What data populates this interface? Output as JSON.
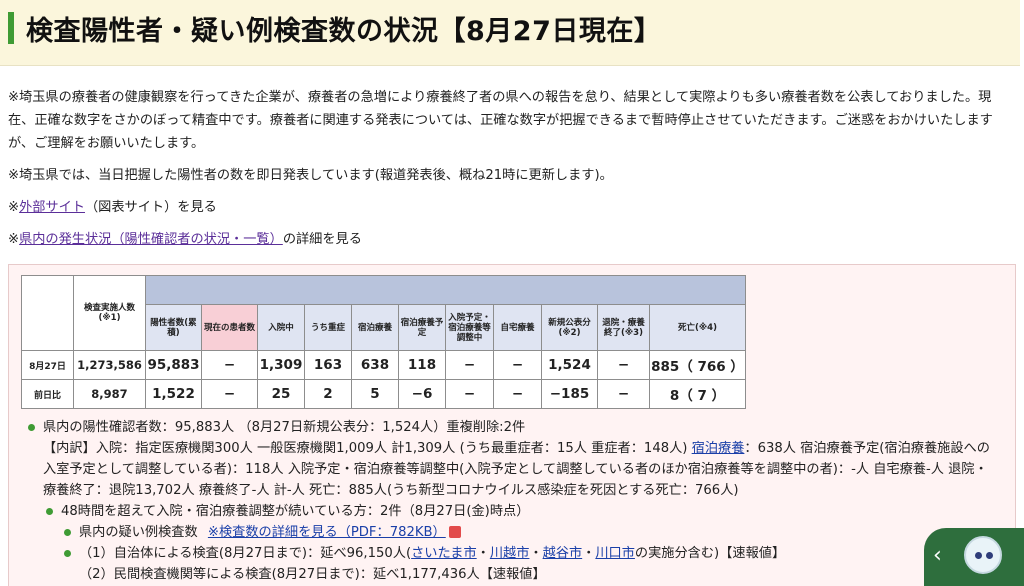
{
  "title": "検査陽性者・疑い例検査数の状況【8月27日現在】",
  "notes": {
    "notice": "※埼玉県の療養者の健康観察を行ってきた企業が、療養者の急増により療養終了者の県への報告を怠り、結果として実際よりも多い療養者数を公表しておりました。現在、正確な数字をさかのぼって精査中です。療養者に関連する発表については、正確な数字が把握できるまで暫時停止させていただきます。ご迷惑をおかけいたしますが、ご理解をお願いいたします。",
    "daily": "※埼玉県では、当日把握した陽性者の数を即日発表しています(報道発表後、概ね21時に更新します)。",
    "external_prefix": "※",
    "external_link": "外部サイト",
    "external_suffix": "（図表サイト）を見る",
    "local_prefix": "※",
    "local_link": "県内の発生状況（陽性確認者の状況・一覧）",
    "local_suffix": "の詳細を見る"
  },
  "table": {
    "headers": [
      "検査実施人数(※1)",
      "陽性者数(累積)",
      "現在の患者数",
      "入院中",
      "うち重症",
      "宿泊療養",
      "宿泊療養予定",
      "入院予定・宿泊療養等調整中",
      "自宅療養",
      "新規公表分(※2)",
      "退院・療養終了(※3)",
      "死亡(※4)"
    ],
    "rows": [
      {
        "label": "8月27日",
        "cells": [
          "1,273,586",
          "95,883",
          "−",
          "1,309",
          "163",
          "638",
          "118",
          "−",
          "−",
          "1,524",
          "−",
          "885（ 766 ）"
        ]
      },
      {
        "label": "前日比",
        "cells": [
          "8,987",
          "1,522",
          "−",
          "25",
          "2",
          "5",
          "−6",
          "−",
          "−",
          "−185",
          "−",
          "8（ 7 ）"
        ]
      }
    ]
  },
  "detail": {
    "line1": "県内の陽性確認者数：95,883人 （8月27日新規公表分：1,524人）重複削除:2件",
    "breakdown_a": "【内訳】入院：指定医療機関300人 一般医療機関1,009人 計1,309人 (うち最重症者：15人 重症者：148人)",
    "breakdown_link": "宿泊療養",
    "breakdown_b": "：638人 宿泊療養予定(宿泊療養施設への入室予定として調整している者)：118人 入院予定・宿泊療養等調整中(入院予定として調整している者のほか宿泊療養等を調整中の者)：-人 自宅療養-人 退院・療養終了：退院13,702人 療養終了-人 計-人 死亡：885人(うち新型コロナウイルス感染症を死因とする死亡：766人)",
    "line48": "48時間を超えて入院・宿泊療養調整が続いている方：2件（8月27日(金)時点）",
    "suspect_label": "県内の疑い例検査数",
    "suspect_link": "※検査数の詳細を見る（PDF：782KB）",
    "test1_a": "（1）自治体による検査(8月27日まで)：延べ96,150人(",
    "cities": [
      "さいたま市",
      "川越市",
      "越谷市",
      "川口市"
    ],
    "test1_b": "の実施分含む)【速報値】",
    "test2": "（2）民間検査機関等による検査(8月27日まで)：延べ1,177,436人【速報値】"
  },
  "pagetop_icon": "chevron-left"
}
